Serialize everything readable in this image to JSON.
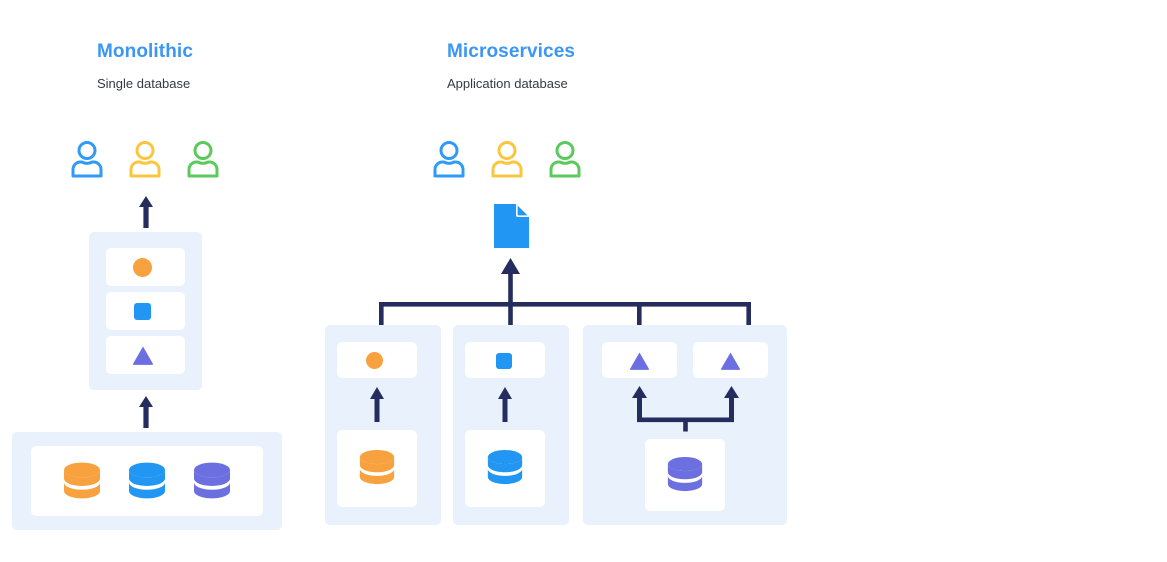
{
  "diagram": {
    "title_color": "#3b96f5",
    "subtitle_color": "#333a44",
    "panel_bg": "#e8f1fc",
    "card_bg": "#ffffff",
    "connector_color": "#252c5e",
    "page_bg": "#ffffff"
  },
  "columns": [
    {
      "id": "monolithic",
      "title": "Monolithic",
      "subtitle": "Single database"
    },
    {
      "id": "microservices",
      "title": "Microservices",
      "subtitle": "Application database"
    }
  ],
  "users": {
    "icon": "user-icon",
    "colors": [
      "#2f9bf7",
      "#fbc63f",
      "#5cc95c"
    ],
    "labels": [
      "user-blue",
      "user-yellow",
      "user-green"
    ]
  },
  "shapes": {
    "circle": {
      "name": "circle-service-icon",
      "color": "#f8a13f"
    },
    "square": {
      "name": "square-service-icon",
      "color": "#2196f3"
    },
    "triangle": {
      "name": "triangle-service-icon",
      "color": "#6c6fe0"
    }
  },
  "databases": {
    "icon": "database-icon",
    "orange": "#f8a13f",
    "blue": "#2196f3",
    "purple": "#6c6fe0"
  },
  "document": {
    "icon": "document-icon",
    "color": "#2196f3"
  },
  "monolithic_app": {
    "label": "monolithic-application",
    "services": [
      "circle",
      "square",
      "triangle"
    ]
  },
  "monolithic_db": {
    "label": "monolithic-shared-database",
    "databases": [
      "orange",
      "blue",
      "purple"
    ]
  },
  "microservice_groups": [
    {
      "label": "microservice-group-orange",
      "services": [
        "circle"
      ],
      "databases": [
        "orange"
      ]
    },
    {
      "label": "microservice-group-blue",
      "services": [
        "square"
      ],
      "databases": [
        "blue"
      ]
    },
    {
      "label": "microservice-group-purple",
      "services": [
        "triangle",
        "triangle"
      ],
      "databases": [
        "purple"
      ]
    }
  ],
  "connectors": {
    "mono_app_to_users": "arrow-up",
    "mono_db_to_app": "arrow-up",
    "bus_to_document": "arrow-up",
    "service_bus": "horizontal-bus",
    "db_to_service": "arrow-up",
    "shared_db_branch": "branching-arrow-up"
  }
}
